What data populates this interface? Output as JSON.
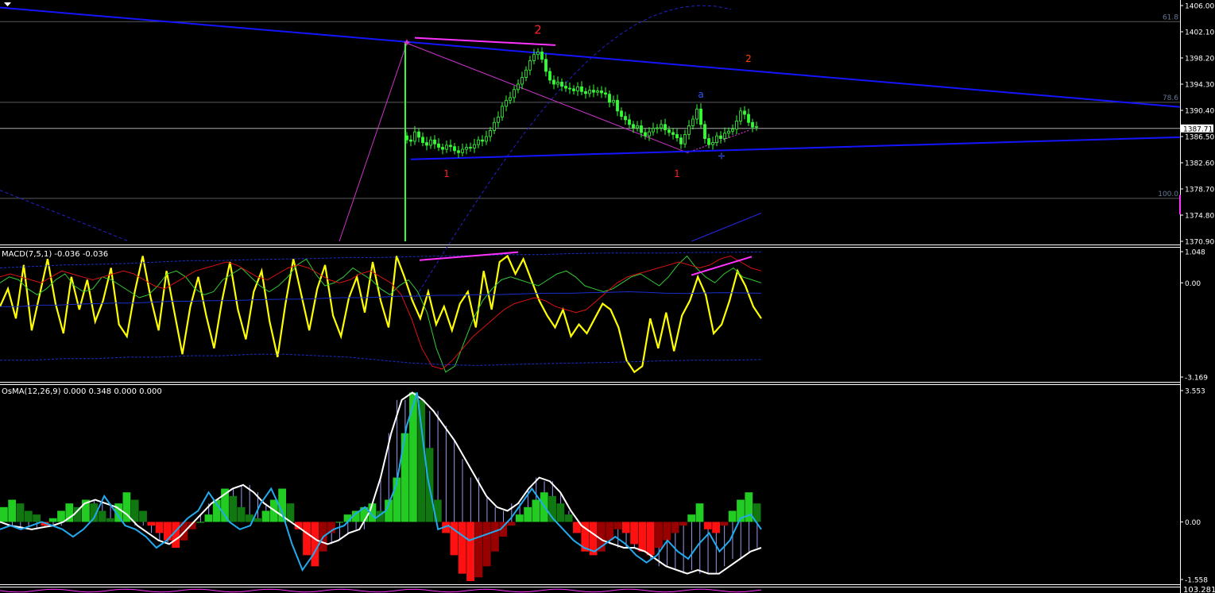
{
  "colors": {
    "background": "#000000",
    "axis_text": "#ffffff",
    "price_grid": "#5a5a5a",
    "trendline": "#1414ff",
    "fib_line": "#cc33cc",
    "magenta": "#ff33ff",
    "candle": "#33ff33",
    "wave_red": "#ff2020",
    "wave_orange": "#ff4400",
    "wave_a": "#3355ff",
    "dashed_blue": "#2222cc",
    "macd_yellow": "#ffff00",
    "macd_green": "#33cc33",
    "macd_red": "#dd1111",
    "macd_blue": "#1a2ecc",
    "osma_green": "#22cc22",
    "osma_darkgreen": "#117711",
    "osma_red": "#ff1111",
    "osma_darkred": "#990000",
    "osma_white": "#ffffff",
    "osma_cyan": "#22aaee",
    "osma_hatch": "#9999ee"
  },
  "chart_data": [
    {
      "type": "candlestick",
      "panel": "price",
      "ylim": [
        1370.9,
        1406.0
      ],
      "y_ticks": [
        "1406.00",
        "1402.10",
        "1398.20",
        "1394.30",
        "1390.40",
        "1386.50",
        "1382.60",
        "1378.70",
        "1374.80",
        "1370.90"
      ],
      "current_price": "1387.71",
      "close_series": [
        1386.0,
        1385.8,
        1387.2,
        1386.4,
        1385.6,
        1385.2,
        1386.0,
        1385.4,
        1384.9,
        1384.6,
        1385.2,
        1385.0,
        1384.4,
        1384.1,
        1384.6,
        1384.9,
        1384.8,
        1385.3,
        1386.0,
        1385.8,
        1386.5,
        1387.4,
        1388.6,
        1389.4,
        1391.0,
        1391.9,
        1392.3,
        1393.5,
        1394.3,
        1395.3,
        1396.4,
        1397.8,
        1398.7,
        1399.1,
        1398.0,
        1396.2,
        1394.9,
        1394.3,
        1394.6,
        1394.0,
        1393.7,
        1393.6,
        1393.3,
        1393.9,
        1393.2,
        1392.9,
        1393.4,
        1393.1,
        1393.3,
        1393.0,
        1392.8,
        1391.6,
        1391.9,
        1390.3,
        1389.5,
        1389.0,
        1388.3,
        1387.8,
        1388.1,
        1387.1,
        1386.6,
        1387.2,
        1387.7,
        1387.8,
        1388.3,
        1387.5,
        1387.1,
        1386.8,
        1386.3,
        1385.4,
        1386.8,
        1388.1,
        1389.1,
        1390.6,
        1388.3,
        1386.2,
        1385.3,
        1385.6,
        1386.6,
        1386.2,
        1387.0,
        1387.3,
        1387.6,
        1388.8,
        1390.3,
        1389.8,
        1388.6,
        1387.9,
        1388.0
      ],
      "spike_low": 1370.9,
      "fib_levels": [
        {
          "label": "61.8",
          "value": 1403.6
        },
        {
          "label": "78.6",
          "value": 1391.6
        },
        {
          "label": "100.0",
          "value": 1377.3
        }
      ],
      "wave_labels": [
        {
          "text": "2",
          "color": "red",
          "x_index": 33,
          "y": 1401.8
        },
        {
          "text": "1",
          "color": "red",
          "x_index": 10,
          "y": 1380.5
        },
        {
          "text": "1",
          "color": "red",
          "x_index": 68,
          "y": 1380.5
        },
        {
          "text": "2",
          "color": "orange",
          "x_index": 86,
          "y": 1397.6
        },
        {
          "text": "a",
          "color": "blue",
          "x_index": 74,
          "y": 1392.3
        }
      ]
    },
    {
      "type": "line",
      "panel": "macd",
      "title": "MACD(7,5,1) -0.036 -0.036",
      "ylim": [
        -3.169,
        1.048
      ],
      "y_ticks": [
        "1.048",
        "0.00",
        "-3.169"
      ],
      "series": [
        {
          "color": "yellow",
          "values": [
            -0.8,
            -0.2,
            -1.2,
            0.6,
            -1.6,
            -0.4,
            0.8,
            -0.7,
            -1.7,
            0.2,
            -0.9,
            0.1,
            -1.3,
            -0.6,
            0.5,
            -1.4,
            -1.8,
            -0.3,
            0.9,
            -0.5,
            -1.6,
            0.4,
            -1.0,
            -2.4,
            -0.8,
            0.2,
            -1.1,
            -2.2,
            -0.6,
            0.7,
            -0.9,
            -1.9,
            -0.3,
            0.4,
            -1.3,
            -2.5,
            -0.7,
            0.8,
            -0.4,
            -1.6,
            -0.2,
            0.6,
            -1.1,
            -1.8,
            -0.5,
            0.2,
            -1.0,
            0.7,
            -0.6,
            -1.5,
            0.9,
            0.2,
            -0.6,
            -1.2,
            -0.3,
            -1.4,
            -0.8,
            -1.6,
            -0.7,
            -0.3,
            -1.5,
            0.4,
            -0.9,
            0.7,
            0.9,
            0.3,
            0.8,
            0.1,
            -0.6,
            -1.1,
            -1.5,
            -0.9,
            -1.8,
            -1.4,
            -1.7,
            -1.2,
            -0.7,
            -0.9,
            -1.5,
            -2.6,
            -3.0,
            -2.8,
            -1.2,
            -2.2,
            -1.0,
            -2.3,
            -1.1,
            -0.6,
            0.2,
            -0.4,
            -1.7,
            -1.4,
            -0.6,
            0.4,
            -0.1,
            -0.8,
            -1.2
          ]
        },
        {
          "color": "green",
          "values": [
            0.0,
            0.2,
            0.1,
            -0.2,
            -0.4,
            -0.2,
            0.1,
            0.3,
            -0.1,
            -0.3,
            -0.2,
            0.2,
            0.1,
            -0.1,
            -0.3,
            -0.5,
            -0.4,
            -0.1,
            0.3,
            0.4,
            0.2,
            -0.2,
            -0.4,
            -0.3,
            0.1,
            0.3,
            0.5,
            0.2,
            -0.1,
            -0.3,
            -0.1,
            0.2,
            0.6,
            0.8,
            0.3,
            -0.1,
            0.0,
            0.2,
            0.5,
            0.3,
            0.1,
            -0.2,
            -0.4,
            -0.1,
            0.1,
            -0.3,
            -1.0,
            -2.2,
            -3.0,
            -2.8,
            -2.0,
            -1.2,
            -0.6,
            -0.2,
            0.1,
            0.2,
            0.1,
            0.0,
            -0.1,
            0.1,
            0.3,
            0.4,
            0.2,
            -0.1,
            -0.2,
            -0.3,
            -0.2,
            0.0,
            0.2,
            0.3,
            0.1,
            -0.1,
            0.2,
            0.6,
            0.9,
            0.5,
            0.2,
            0.0,
            0.3,
            0.5,
            0.2,
            0.1,
            0.0
          ]
        },
        {
          "color": "red",
          "values": [
            0.2,
            0.3,
            0.2,
            0.1,
            0.0,
            0.2,
            0.4,
            0.3,
            0.2,
            0.1,
            0.2,
            0.3,
            0.4,
            0.3,
            0.1,
            -0.1,
            -0.2,
            0.0,
            0.2,
            0.4,
            0.5,
            0.6,
            0.7,
            0.6,
            0.4,
            0.2,
            0.1,
            0.3,
            0.5,
            0.6,
            0.5,
            0.3,
            0.1,
            0.0,
            0.1,
            0.3,
            0.4,
            0.2,
            0.0,
            -0.4,
            -1.2,
            -2.2,
            -2.8,
            -2.9,
            -2.6,
            -2.2,
            -1.8,
            -1.5,
            -1.2,
            -0.9,
            -0.7,
            -0.6,
            -0.5,
            -0.6,
            -0.8,
            -0.9,
            -1.0,
            -0.9,
            -0.6,
            -0.3,
            0.0,
            0.2,
            0.3,
            0.4,
            0.5,
            0.6,
            0.7,
            0.6,
            0.5,
            0.6,
            0.8,
            0.9,
            0.7,
            0.5,
            0.4
          ]
        },
        {
          "color": "blue",
          "values": [
            -0.8,
            -0.8,
            -0.75,
            -0.75,
            -0.72,
            -0.7,
            -0.68,
            -0.68,
            -0.65,
            -0.62,
            -0.62,
            -0.6,
            -0.6,
            -0.58,
            -0.56,
            -0.55,
            -0.55,
            -0.52,
            -0.5,
            -0.5,
            -0.48,
            -0.45,
            -0.45,
            -0.42,
            -0.42,
            -0.4,
            -0.4,
            -0.38,
            -0.36,
            -0.35,
            -0.35,
            -0.33,
            -0.32,
            -0.3,
            -0.32,
            -0.35,
            -0.36,
            -0.34,
            -0.33,
            -0.34,
            -0.35
          ]
        },
        {
          "color": "blue_dashed_upper",
          "values": [
            0.5,
            0.55,
            0.6,
            0.62,
            0.65,
            0.7,
            0.75,
            0.75,
            0.78,
            0.8,
            0.82,
            0.85,
            0.85,
            0.88,
            0.9,
            0.92,
            0.95,
            0.95,
            0.98,
            1.0,
            1.0,
            1.0,
            1.02,
            1.02,
            1.04
          ]
        },
        {
          "color": "blue_dashed_lower",
          "values": [
            -2.6,
            -2.6,
            -2.55,
            -2.55,
            -2.5,
            -2.5,
            -2.45,
            -2.45,
            -2.4,
            -2.4,
            -2.45,
            -2.5,
            -2.6,
            -2.7,
            -2.75,
            -2.78,
            -2.75,
            -2.72,
            -2.7,
            -2.68,
            -2.65,
            -2.62,
            -2.6,
            -2.6,
            -2.58
          ]
        }
      ]
    },
    {
      "type": "bar",
      "panel": "osma",
      "title": "OsMA(12,26,9) 0.000 0.348 0.000 0.000",
      "ylim": [
        -1.558,
        3.553
      ],
      "y_ticks": [
        "3.553",
        "0.00",
        "-1.558"
      ],
      "histogram": [
        0.4,
        0.6,
        0.5,
        0.3,
        0.2,
        -0.1,
        0.1,
        0.3,
        0.5,
        0.4,
        0.6,
        0.5,
        0.3,
        0.1,
        0.5,
        0.8,
        0.6,
        0.3,
        -0.1,
        -0.3,
        -0.5,
        -0.7,
        -0.5,
        -0.2,
        0.0,
        0.2,
        0.6,
        0.9,
        0.7,
        0.4,
        0.2,
        0.1,
        0.3,
        0.6,
        0.9,
        0.5,
        -0.2,
        -0.9,
        -1.2,
        -0.8,
        -0.3,
        0.0,
        0.2,
        0.3,
        0.4,
        0.5,
        0.3,
        0.6,
        1.2,
        2.4,
        3.5,
        3.3,
        2.0,
        0.6,
        -0.3,
        -0.9,
        -1.4,
        -1.6,
        -1.5,
        -1.2,
        -0.8,
        -0.4,
        -0.1,
        0.2,
        0.4,
        0.6,
        0.8,
        0.7,
        0.5,
        0.2,
        -0.3,
        -0.8,
        -0.9,
        -0.8,
        -0.5,
        -0.2,
        -0.3,
        -0.6,
        -0.8,
        -0.9,
        -0.7,
        -0.5,
        -0.3,
        -0.1,
        0.2,
        0.5,
        -0.2,
        -0.3,
        -0.1,
        0.3,
        0.6,
        0.8,
        0.5
      ],
      "series": [
        {
          "color": "white",
          "values": [
            0.0,
            -0.1,
            -0.15,
            -0.2,
            -0.15,
            -0.1,
            0.0,
            0.2,
            0.5,
            0.6,
            0.5,
            0.4,
            0.2,
            -0.1,
            -0.3,
            -0.5,
            -0.6,
            -0.4,
            -0.1,
            0.2,
            0.5,
            0.7,
            0.9,
            1.0,
            0.8,
            0.5,
            0.3,
            0.1,
            -0.1,
            -0.3,
            -0.5,
            -0.6,
            -0.5,
            -0.3,
            -0.2,
            0.3,
            1.2,
            2.4,
            3.3,
            3.5,
            3.3,
            3.0,
            2.6,
            2.2,
            1.7,
            1.2,
            0.7,
            0.4,
            0.3,
            0.5,
            0.9,
            1.2,
            1.1,
            0.8,
            0.3,
            -0.1,
            -0.3,
            -0.5,
            -0.6,
            -0.7,
            -0.7,
            -0.8,
            -1.0,
            -1.2,
            -1.3,
            -1.4,
            -1.3,
            -1.4,
            -1.4,
            -1.2,
            -1.0,
            -0.8,
            -0.7
          ]
        },
        {
          "color": "cyan",
          "values": [
            -0.2,
            -0.1,
            -0.2,
            -0.1,
            0.0,
            -0.1,
            -0.2,
            -0.4,
            -0.2,
            0.1,
            0.7,
            0.3,
            -0.1,
            -0.2,
            -0.4,
            -0.7,
            -0.5,
            -0.2,
            0.1,
            0.3,
            0.8,
            0.4,
            0.0,
            -0.2,
            -0.1,
            0.5,
            0.9,
            0.3,
            -0.6,
            -1.3,
            -0.9,
            -0.4,
            -0.2,
            -0.1,
            0.2,
            0.4,
            0.1,
            0.3,
            1.0,
            2.6,
            3.5,
            1.2,
            -0.2,
            -0.1,
            -0.3,
            -0.5,
            -0.4,
            -0.3,
            -0.2,
            0.1,
            0.5,
            0.9,
            0.5,
            0.1,
            -0.2,
            -0.5,
            -0.7,
            -0.8,
            -0.6,
            -0.4,
            -0.6,
            -0.9,
            -1.1,
            -0.9,
            -0.5,
            -0.8,
            -1.0,
            -0.6,
            -0.3,
            -0.8,
            -0.5,
            0.1,
            0.2,
            -0.2
          ]
        }
      ]
    }
  ],
  "bottom_panel": {
    "label": "103.2818"
  }
}
